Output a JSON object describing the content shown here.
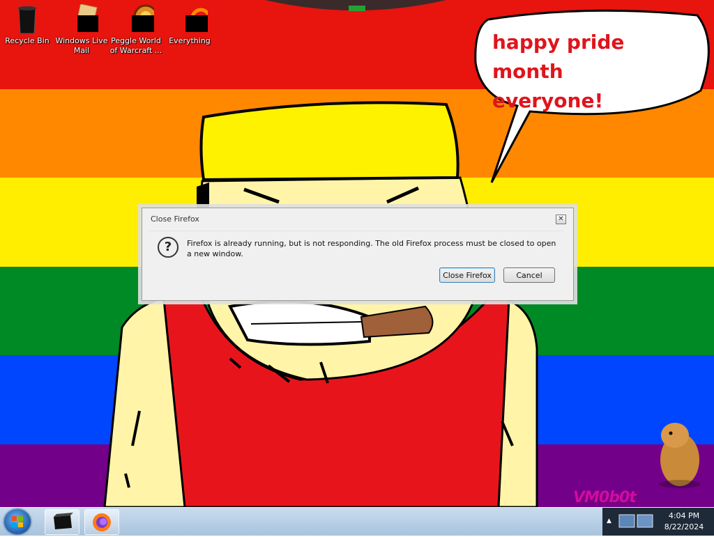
{
  "desktop": {
    "icons": [
      {
        "label": "Recycle Bin",
        "icon": "recycle-bin-icon"
      },
      {
        "label": "Windows Live Mail",
        "icon": "mail-icon"
      },
      {
        "label": "Peggle World of Warcraft ...",
        "icon": "peggle-icon"
      },
      {
        "label": "Everything",
        "icon": "search-icon"
      }
    ],
    "speech_text": "happy pride month everyone!",
    "watermark": "VM0b0t"
  },
  "dialog": {
    "title": "Close Firefox",
    "close_glyph": "✕",
    "icon": "question-icon",
    "icon_glyph": "?",
    "message": "Firefox is already running, but is not responding. The old Firefox process must be closed to open a new window.",
    "primary_button": "Close Firefox",
    "cancel_button": "Cancel"
  },
  "taskbar": {
    "start": "windows-start-icon",
    "pinned": [
      "terminal-icon",
      "firefox-icon"
    ],
    "tray_arrow": "▲",
    "time": "4:04 PM",
    "date": "8/22/2024"
  },
  "colors": {
    "red": "#e8140e",
    "orange": "#ff8800",
    "yellow": "#ffee00",
    "green": "#008a26",
    "blue": "#0046ff",
    "purple": "#730088"
  }
}
